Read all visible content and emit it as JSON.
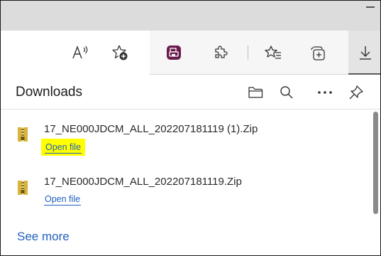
{
  "toolbar": {
    "icons": [
      "read-aloud-icon",
      "add-favorite-icon",
      "extension-app-icon",
      "extensions-icon",
      "favorites-icon",
      "collections-icon",
      "downloads-icon"
    ]
  },
  "downloads_panel": {
    "title": "Downloads",
    "header_icons": [
      "open-folder-icon",
      "search-icon",
      "more-options-icon",
      "pin-icon"
    ],
    "items": [
      {
        "file_name": "17_NE000JDCM_ALL_202207181119 (1).Zip",
        "action": "Open file",
        "highlighted": true
      },
      {
        "file_name": "17_NE000JDCM_ALL_202207181119.Zip",
        "action": "Open file",
        "highlighted": false
      }
    ],
    "see_more": "See more"
  },
  "colors": {
    "link": "#1f5fbf",
    "highlight": "#ffff00",
    "zip_icon": "#d9b43a",
    "extension_app_icon": "#6a1b4d"
  }
}
